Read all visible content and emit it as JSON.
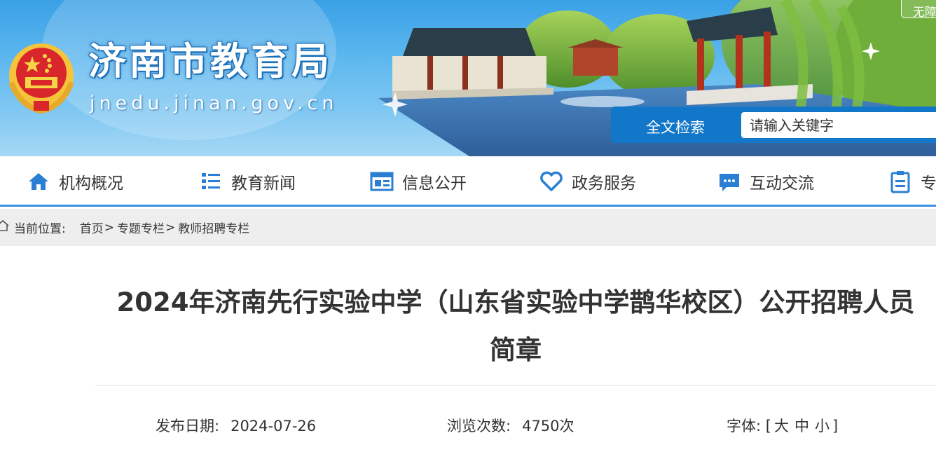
{
  "header": {
    "site_title": "济南市教育局",
    "site_domain": "jnedu.jinan.gov.cn",
    "top_button_label": "无障",
    "search": {
      "label": "全文检索",
      "placeholder": "请输入关键字"
    }
  },
  "nav": {
    "items": [
      {
        "label": "机构概况",
        "icon": "home-icon"
      },
      {
        "label": "教育新闻",
        "icon": "list-icon"
      },
      {
        "label": "信息公开",
        "icon": "newspaper-icon"
      },
      {
        "label": "政务服务",
        "icon": "heart-icon"
      },
      {
        "label": "互动交流",
        "icon": "chat-icon"
      },
      {
        "label": "专",
        "icon": "clipboard-icon"
      }
    ]
  },
  "breadcrumb": {
    "label": "当前位置:",
    "items": [
      "首页",
      "专题专栏",
      "教师招聘专栏"
    ],
    "separator": ">"
  },
  "article": {
    "title_line1": "2024年济南先行实验中学（山东省实验中学鹊华校区）公开招聘人员",
    "title_line2": "简章",
    "publish_label": "发布日期:",
    "publish_date": "2024-07-26",
    "views_label": "浏览次数:",
    "views_value": "4750次",
    "font_label": "字体:",
    "font_open": "[",
    "font_large": "大",
    "font_medium": "中",
    "font_small": "小",
    "font_close": "]"
  },
  "colors": {
    "banner_blue": "#3aa0e6",
    "search_blue": "#1277c9",
    "nav_icon_blue": "#2a7fd4",
    "nav_border": "#3d8fe0",
    "crumb_bg": "#eeeeee"
  }
}
